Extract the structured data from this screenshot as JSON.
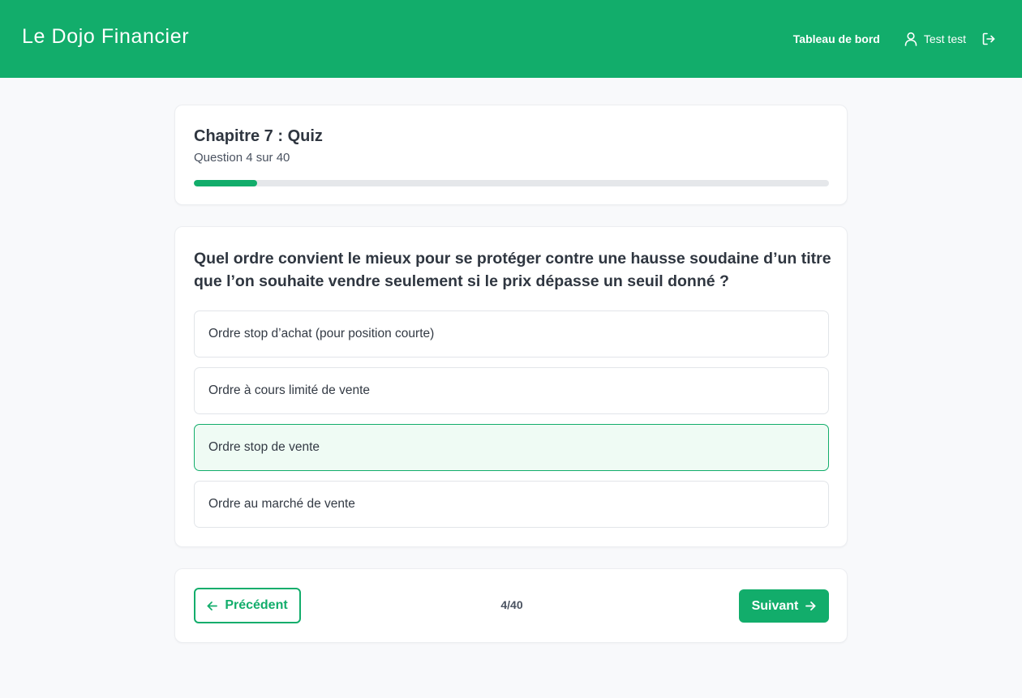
{
  "header": {
    "brand": "Le Dojo Financier",
    "nav_dashboard": "Tableau de bord",
    "user_name": "Test test",
    "icons": {
      "user": "user-icon",
      "logout": "logout-icon"
    },
    "bg_color": "#12ad6b"
  },
  "quiz": {
    "title": "Chapitre 7 : Quiz",
    "progress_label": "Question 4 sur 40",
    "progress_fraction": 0.1,
    "question": "Quel ordre convient le mieux pour se protéger contre une hausse soudaine d’un titre que l’on souhaite vendre seulement si le prix dépasse un seuil donné ?",
    "options": [
      {
        "label": "Ordre stop d’achat (pour position courte)",
        "selected": false
      },
      {
        "label": "Ordre à cours limité de vente",
        "selected": false
      },
      {
        "label": "Ordre stop de vente",
        "selected": true
      },
      {
        "label": "Ordre au marché de vente",
        "selected": false
      }
    ]
  },
  "navigation": {
    "prev_label": "Précédent",
    "counter": "4/40",
    "next_label": "Suivant",
    "icons": {
      "prev": "arrow-left-icon",
      "next": "arrow-right-icon"
    }
  },
  "colors": {
    "accent": "#12ad6b",
    "selected_bg": "#effbf4",
    "page_bg": "#f8f9fb"
  }
}
